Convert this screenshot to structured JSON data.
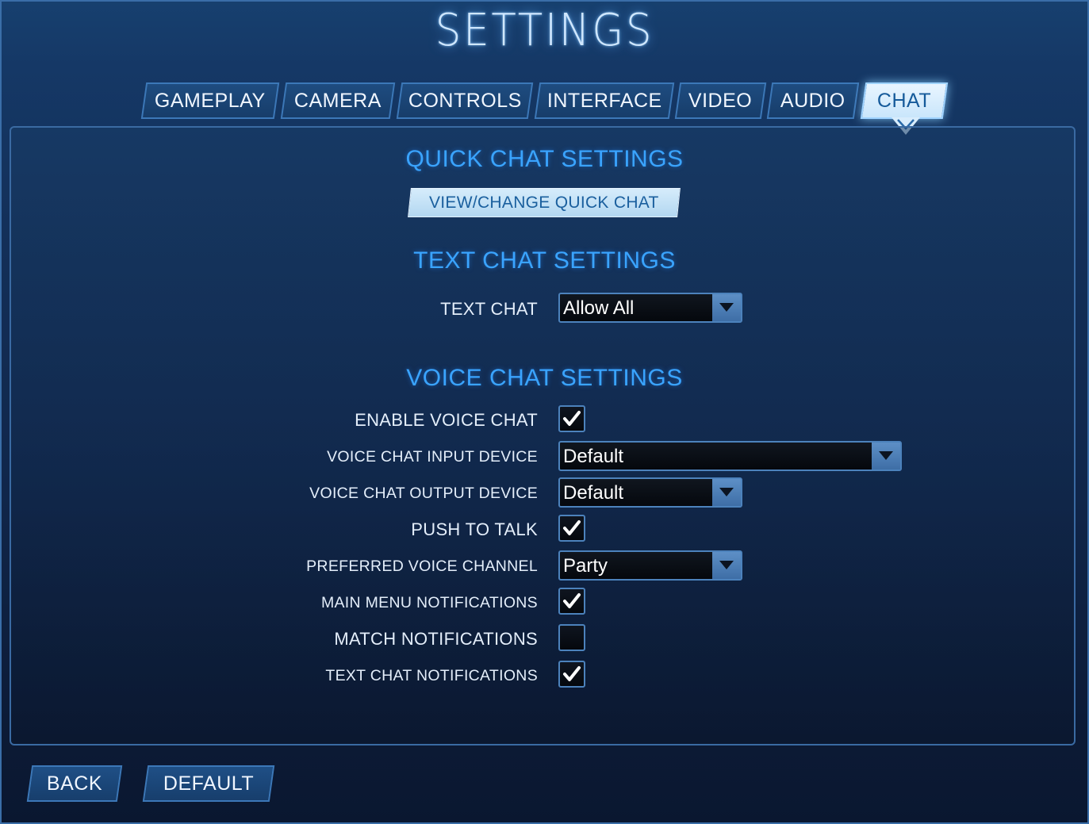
{
  "title": "SETTINGS",
  "tabs": [
    {
      "label": "GAMEPLAY"
    },
    {
      "label": "CAMERA"
    },
    {
      "label": "CONTROLS"
    },
    {
      "label": "INTERFACE"
    },
    {
      "label": "VIDEO"
    },
    {
      "label": "AUDIO"
    },
    {
      "label": "CHAT"
    }
  ],
  "active_tab": "CHAT",
  "quick_chat": {
    "heading": "QUICK CHAT SETTINGS",
    "button_label": "VIEW/CHANGE QUICK CHAT"
  },
  "text_chat": {
    "heading": "TEXT CHAT SETTINGS",
    "text_chat_label": "TEXT CHAT",
    "text_chat_value": "Allow All"
  },
  "voice_chat": {
    "heading": "VOICE CHAT SETTINGS",
    "enable_voice_chat": {
      "label": "ENABLE VOICE CHAT",
      "checked": true
    },
    "input_device": {
      "label": "VOICE CHAT INPUT DEVICE",
      "value": "Default"
    },
    "output_device": {
      "label": "VOICE CHAT OUTPUT DEVICE",
      "value": "Default"
    },
    "push_to_talk": {
      "label": "PUSH TO TALK",
      "checked": true
    },
    "preferred_channel": {
      "label": "PREFERRED VOICE CHANNEL",
      "value": "Party"
    },
    "main_menu_notifications": {
      "label": "MAIN MENU NOTIFICATIONS",
      "checked": true
    },
    "match_notifications": {
      "label": "MATCH NOTIFICATIONS",
      "checked": false
    },
    "text_chat_notifications": {
      "label": "TEXT CHAT NOTIFICATIONS",
      "checked": true
    }
  },
  "footer": {
    "back_label": "BACK",
    "default_label": "DEFAULT"
  },
  "colors": {
    "accent": "#3aa4ff",
    "active_tab_bg": "#e9f5ff",
    "checkmark": "#ffffff"
  },
  "icons": {
    "checkbox_checked": "checkmark-icon",
    "dropdown": "chevron-down-icon"
  }
}
